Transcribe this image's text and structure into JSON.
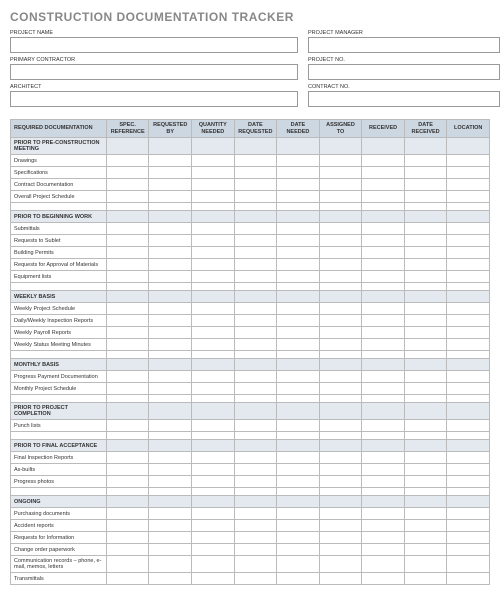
{
  "title": "CONSTRUCTION DOCUMENTATION TRACKER",
  "header_fields": {
    "project_name": {
      "label": "PROJECT NAME",
      "value": ""
    },
    "project_manager": {
      "label": "PROJECT MANAGER",
      "value": ""
    },
    "primary_contractor": {
      "label": "PRIMARY CONTRACTOR",
      "value": ""
    },
    "project_no": {
      "label": "PROJECT NO.",
      "value": ""
    },
    "architect": {
      "label": "ARCHITECT",
      "value": ""
    },
    "contract_no": {
      "label": "CONTRACT NO.",
      "value": ""
    }
  },
  "columns": [
    "REQUIRED DOCUMENTATION",
    "SPEC. REFERENCE",
    "REQUESTED BY",
    "QUANTITY NEEDED",
    "DATE REQUESTED",
    "DATE NEEDED",
    "ASSIGNED TO",
    "RECEIVED",
    "DATE RECEIVED",
    "LOCATION"
  ],
  "sections": [
    {
      "title": "PRIOR TO PRE-CONSTRUCTION MEETING",
      "rows": [
        "Drawings",
        "Specifications",
        "Contract Documentation",
        "Overall Project Schedule"
      ]
    },
    {
      "title": "PRIOR TO BEGINNING WORK",
      "rows": [
        "Submittals",
        "Requests to Sublet",
        "Building Permits",
        "Requests for Approval of Materials",
        "Equipment lists"
      ]
    },
    {
      "title": "WEEKLY BASIS",
      "rows": [
        "Weekly Project Schedule",
        "Daily/Weekly Inspection Reports",
        "Weekly Payroll Reports",
        "Weekly Status Meeting Minutes"
      ]
    },
    {
      "title": "MONTHLY BASIS",
      "rows": [
        "Progress Payment Documentation",
        "Monthly Project Schedule"
      ]
    },
    {
      "title": "PRIOR TO PROJECT COMPLETION",
      "rows": [
        "Punch lists"
      ]
    },
    {
      "title": "PRIOR TO FINAL ACCEPTANCE",
      "rows": [
        "Final Inspection Reports",
        "As-builts",
        "Progress photos"
      ]
    },
    {
      "title": "ONGOING",
      "rows": [
        "Purchasing documents",
        "Accident reports",
        "Requests for Information",
        "Change order paperwork",
        "Communication records – phone, e-mail, memos, letters",
        "Transmittals"
      ]
    }
  ]
}
